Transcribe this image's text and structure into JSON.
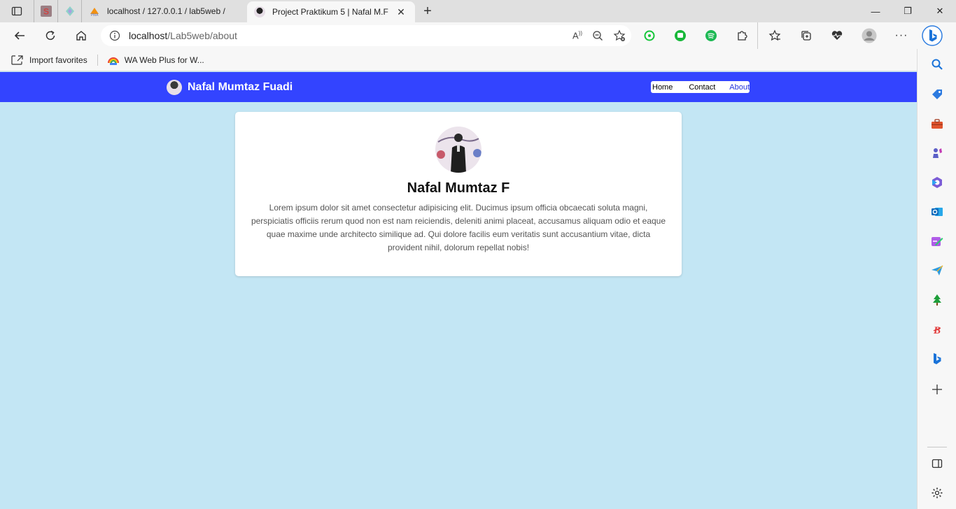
{
  "browser": {
    "tabs": [
      {
        "title": "localhost / 127.0.0.1 / lab5web /",
        "active": false
      },
      {
        "title": "Project Praktikum 5 | Nafal M.F",
        "active": true
      }
    ],
    "address": {
      "host": "localhost",
      "path": "/Lab5web/about"
    },
    "favorites": [
      {
        "label": "Import favorites"
      },
      {
        "label": "WA Web Plus for W..."
      }
    ]
  },
  "site": {
    "brand": "Nafal Mumtaz Fuadi",
    "nav": [
      {
        "label": "Home",
        "active": false
      },
      {
        "label": "Contact",
        "active": false
      },
      {
        "label": "About",
        "active": true
      }
    ],
    "colors": {
      "navbar": "#3344ff",
      "background": "#c3e6f4",
      "active_link": "#2233dd"
    }
  },
  "profile": {
    "name": "Nafal Mumtaz F",
    "bio": "Lorem ipsum dolor sit amet consectetur adipisicing elit. Ducimus ipsum officia obcaecati soluta magni, perspiciatis officiis rerum quod non est nam reiciendis, deleniti animi placeat, accusamus aliquam odio et eaque quae maxime unde architecto similique ad. Qui dolore facilis eum veritatis sunt accusantium vitae, dicta provident nihil, dolorum repellat nobis!"
  }
}
